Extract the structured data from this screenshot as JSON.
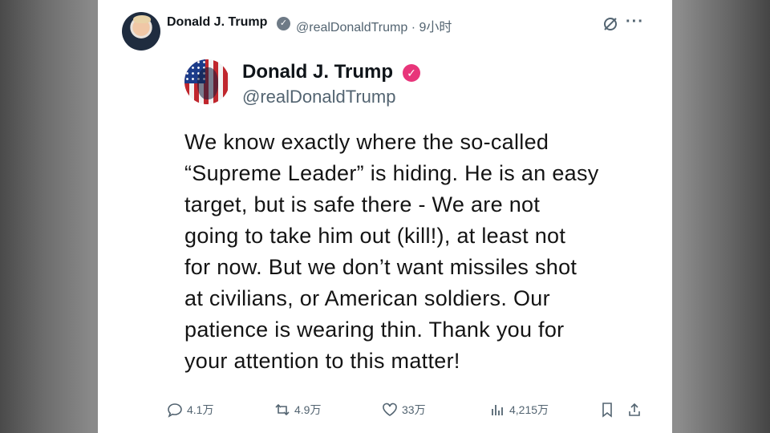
{
  "tweet_header": {
    "name": "Donald J. Trump",
    "handle": "@realDonaldTrump",
    "separator": "·",
    "time": "9小时",
    "icons": [
      "verified-badge-icon",
      "grok-icon",
      "more-icon"
    ]
  },
  "embedded_post": {
    "name": "Donald J. Trump",
    "handle": "@realDonaldTrump",
    "verified_color": "#e8357a",
    "lines": [
      "We know exactly where the so-called",
      "“Supreme Leader” is hiding. He is an easy",
      "target, but is safe there - We are not",
      "going to take him out (kill!), at least not",
      "for now. But we don’t want missiles shot",
      "at civilians, or American soldiers. Our",
      "patience is wearing thin. Thank you for",
      "your attention to this matter!"
    ]
  },
  "actions": {
    "replies": "4.1万",
    "reposts": "4.9万",
    "likes": "33万",
    "views": "4,215万"
  }
}
